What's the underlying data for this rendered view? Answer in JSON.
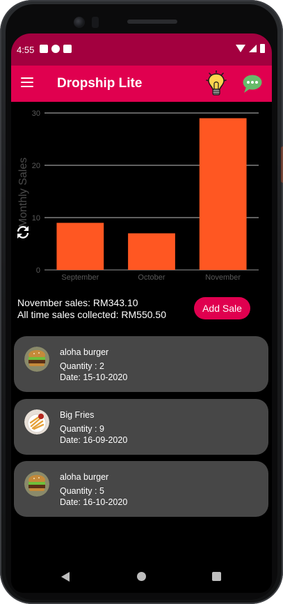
{
  "status_bar": {
    "time": "4:55"
  },
  "app_bar": {
    "title": "Dropship Lite"
  },
  "chart_data": {
    "type": "bar",
    "categories": [
      "September",
      "October",
      "November"
    ],
    "values": [
      9,
      7,
      29
    ],
    "ylabel": "Monthly Sales",
    "ylim": [
      0,
      30
    ],
    "yticks": [
      0,
      10,
      20,
      30
    ],
    "grid": true,
    "bar_color": "#ff5722"
  },
  "sales": {
    "month_line": "November sales: RM343.10",
    "total_line": "All time sales collected: RM550.50",
    "add_button": "Add Sale"
  },
  "orders": [
    {
      "name": "aloha burger",
      "quantity": "Quantity : 2",
      "date": "Date: 15-10-2020",
      "image": "burger-image"
    },
    {
      "name": "Big Fries",
      "quantity": "Quantity : 9",
      "date": "Date: 16-09-2020",
      "image": "fries-image"
    },
    {
      "name": "aloha burger",
      "quantity": "Quantity : 5",
      "date": "Date: 16-10-2020",
      "image": "burger-image"
    }
  ],
  "colors": {
    "primary": "#e0004f",
    "status_bar": "#a3003f",
    "card": "#474747",
    "bar": "#ff5722"
  }
}
